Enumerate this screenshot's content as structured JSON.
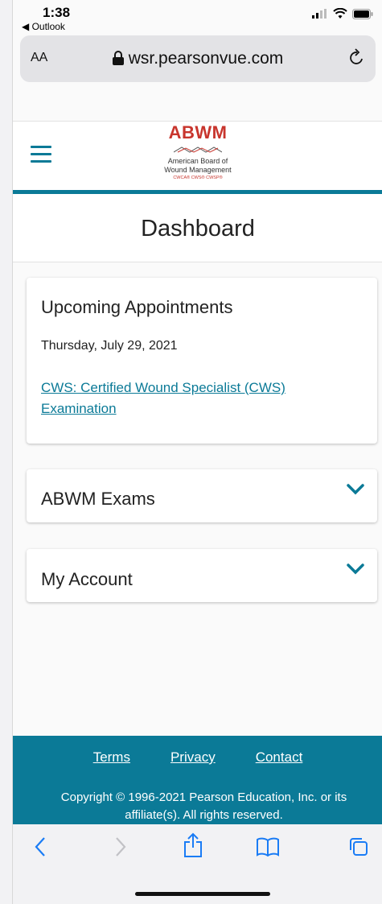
{
  "status_bar": {
    "time": "1:38",
    "back_app": "◀ Outlook"
  },
  "browser": {
    "text_size": "AA",
    "url": "wsr.pearsonvue.com"
  },
  "header": {
    "logo_text": "ABWM",
    "logo_line1": "American Board of",
    "logo_line2": "Wound Management",
    "logo_creds": "CWCA® CWS® CWSP®",
    "brand_color": "#0b7a97"
  },
  "page": {
    "title": "Dashboard"
  },
  "appointments": {
    "title": "Upcoming Appointments",
    "date": "Thursday, July 29, 2021",
    "exam_link": "CWS: Certified Wound Specialist (CWS) Examination"
  },
  "sections": [
    {
      "title": "ABWM Exams"
    },
    {
      "title": "My Account"
    }
  ],
  "footer": {
    "links": [
      "Terms",
      "Privacy",
      "Contact"
    ],
    "copyright": "Copyright © 1996-2021 Pearson Education, Inc. or its affiliate(s). All rights reserved."
  },
  "toolbar_icons": [
    "back-icon",
    "forward-icon",
    "share-icon",
    "bookmarks-icon",
    "tabs-icon"
  ]
}
